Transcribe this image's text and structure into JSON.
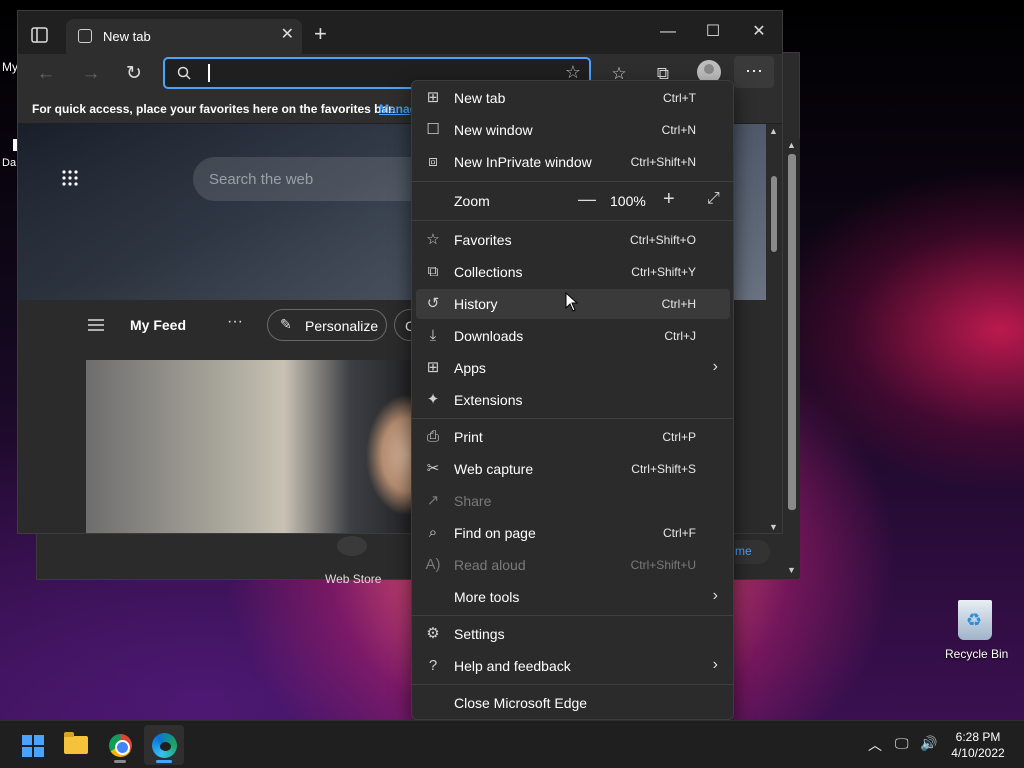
{
  "desktop": {
    "left_labels": [
      "My",
      "Da"
    ],
    "recycle_bin_label": "Recycle Bin"
  },
  "browser": {
    "tab_title": "New tab",
    "address_value": "",
    "favorites_bar_message": "For quick access, place your favorites here on the favorites bar.",
    "favorites_bar_link": "Manage favorites now",
    "hero_search_placeholder": "Search the web",
    "feed_title": "My Feed",
    "personalize_label": "Personalize",
    "next_pill_label": "C"
  },
  "background_window": {
    "web_store_label": "Web Store",
    "home_pill_label": "me"
  },
  "menu": {
    "items": [
      {
        "label": "New tab",
        "shortcut": "Ctrl+T",
        "icon": "new-tab-icon"
      },
      {
        "label": "New window",
        "shortcut": "Ctrl+N",
        "icon": "window-icon"
      },
      {
        "label": "New InPrivate window",
        "shortcut": "Ctrl+Shift+N",
        "icon": "inprivate-icon"
      },
      {
        "label": "Zoom",
        "value": "100%"
      },
      {
        "label": "Favorites",
        "shortcut": "Ctrl+Shift+O",
        "icon": "favorites-icon"
      },
      {
        "label": "Collections",
        "shortcut": "Ctrl+Shift+Y",
        "icon": "collections-icon"
      },
      {
        "label": "History",
        "shortcut": "Ctrl+H",
        "icon": "history-icon"
      },
      {
        "label": "Downloads",
        "shortcut": "Ctrl+J",
        "icon": "download-icon"
      },
      {
        "label": "Apps",
        "icon": "apps-icon"
      },
      {
        "label": "Extensions",
        "icon": "extensions-icon"
      },
      {
        "label": "Print",
        "shortcut": "Ctrl+P",
        "icon": "print-icon"
      },
      {
        "label": "Web capture",
        "shortcut": "Ctrl+Shift+S",
        "icon": "web-capture-icon"
      },
      {
        "label": "Share",
        "icon": "share-icon"
      },
      {
        "label": "Find on page",
        "shortcut": "Ctrl+F",
        "icon": "find-icon"
      },
      {
        "label": "Read aloud",
        "shortcut": "Ctrl+Shift+U",
        "icon": "read-aloud-icon"
      },
      {
        "label": "More tools"
      },
      {
        "label": "Settings",
        "icon": "settings-icon"
      },
      {
        "label": "Help and feedback",
        "icon": "help-icon"
      },
      {
        "label": "Close Microsoft Edge"
      }
    ]
  },
  "taskbar": {
    "time": "6:28 PM",
    "date": "4/10/2022"
  },
  "colors": {
    "accent": "#4aa3ff",
    "menu_bg": "#2b2b2b"
  }
}
